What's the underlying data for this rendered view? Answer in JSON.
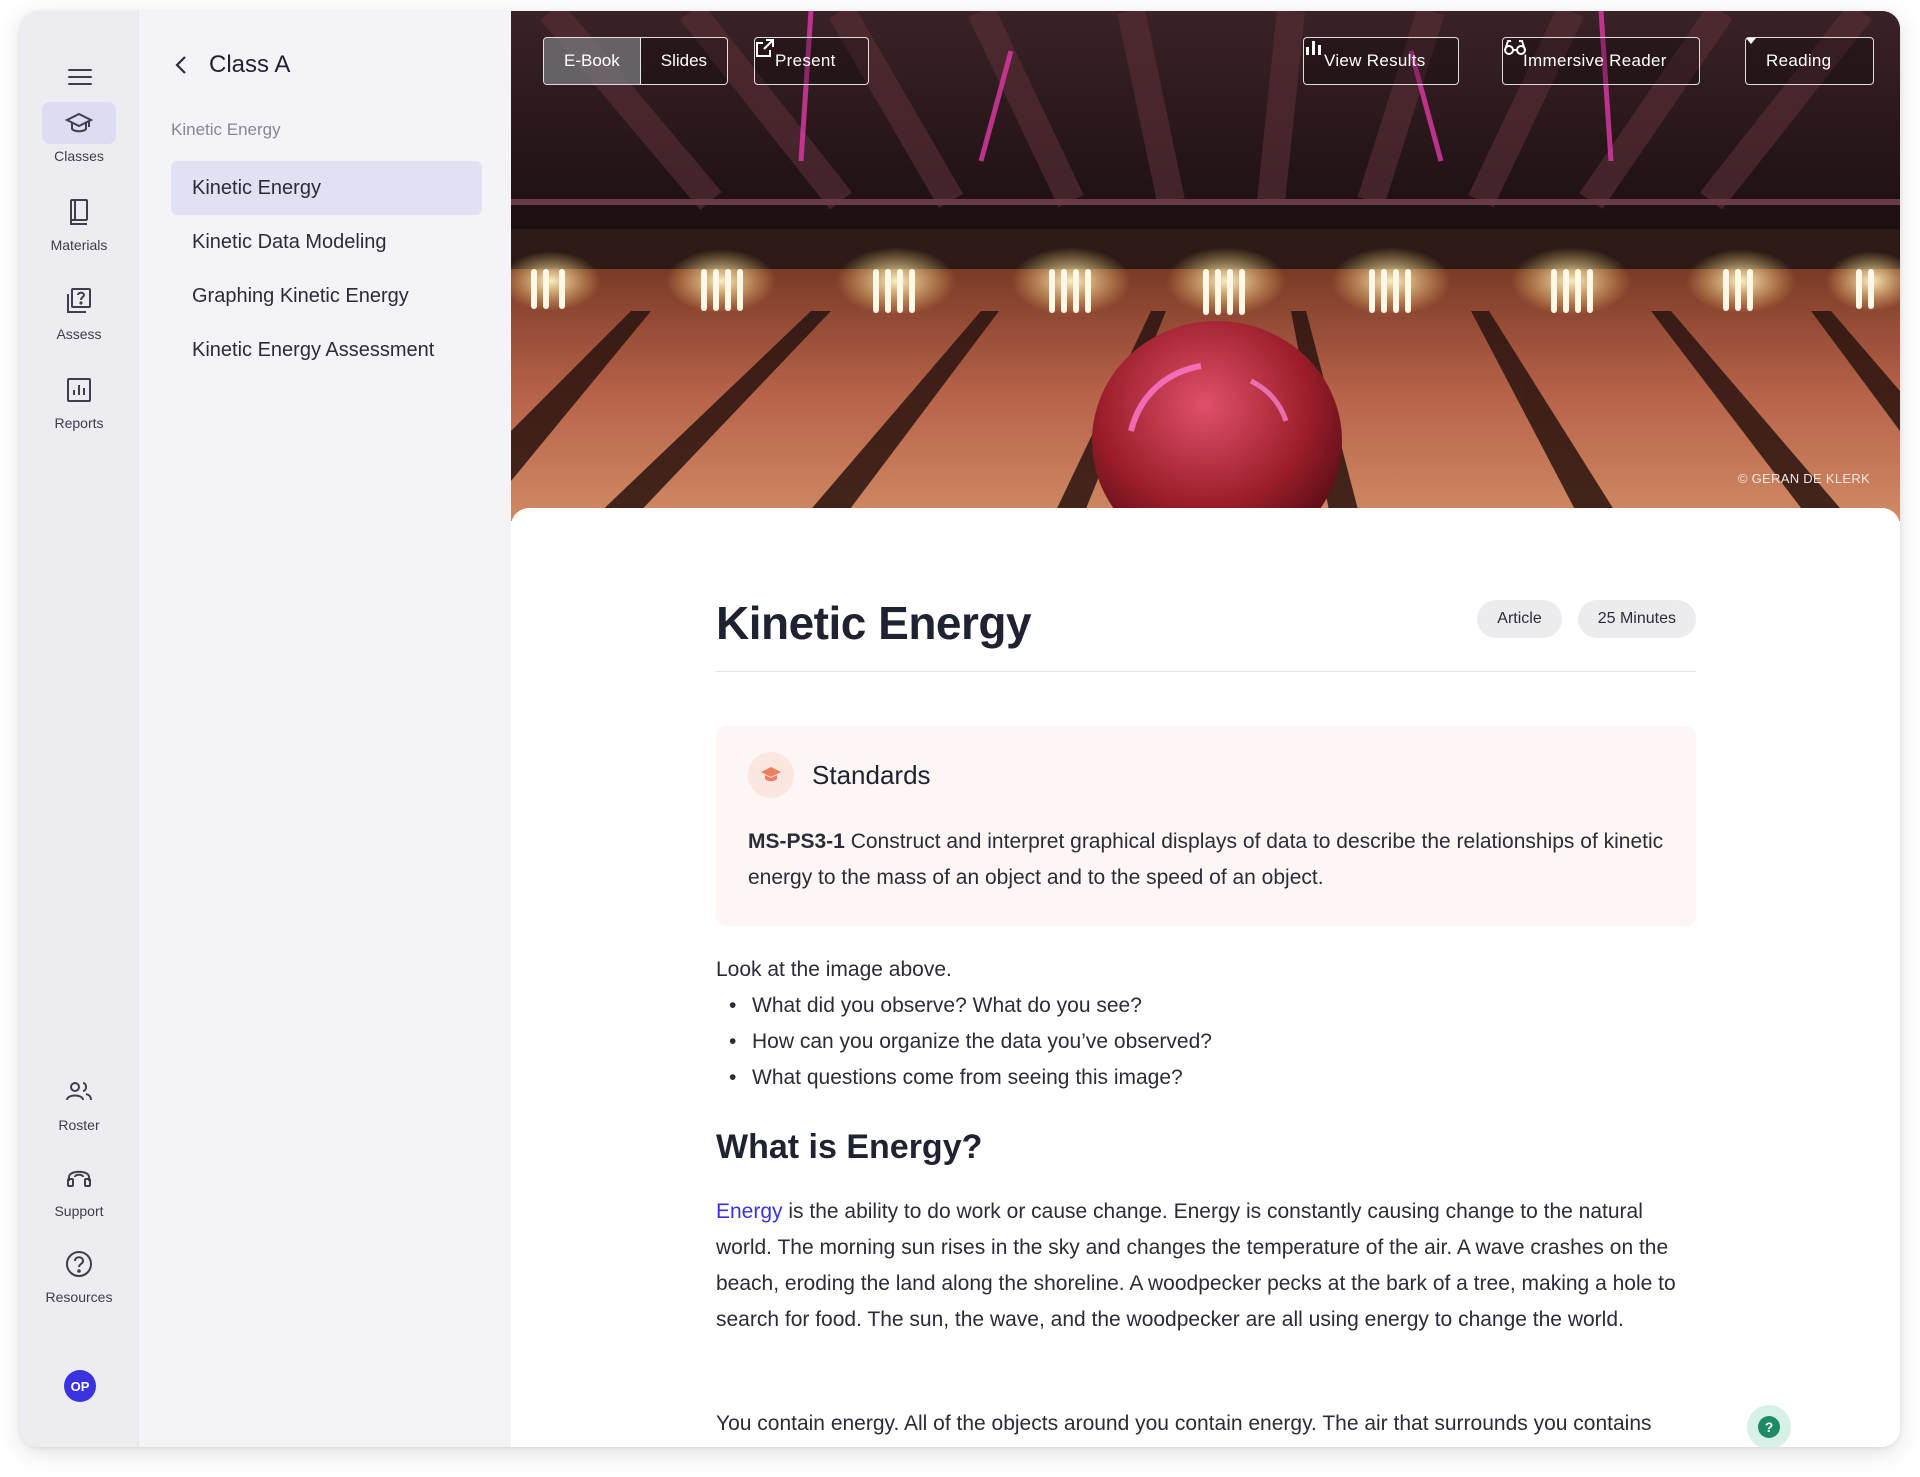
{
  "nav": {
    "items": [
      {
        "label": "Classes",
        "icon": "graduation-cap-icon"
      },
      {
        "label": "Materials",
        "icon": "book-icon"
      },
      {
        "label": "Assess",
        "icon": "quiz-icon"
      },
      {
        "label": "Reports",
        "icon": "bar-chart-icon"
      }
    ],
    "bottom_items": [
      {
        "label": "Roster",
        "icon": "people-icon"
      },
      {
        "label": "Support",
        "icon": "headset-icon"
      },
      {
        "label": "Resources",
        "icon": "help-circle-icon"
      }
    ],
    "avatar_initials": "OP"
  },
  "sidebar": {
    "class_title": "Class A",
    "section_caption": "Kinetic Energy",
    "lessons": [
      {
        "label": "Kinetic Energy",
        "active": true
      },
      {
        "label": "Kinetic Data Modeling"
      },
      {
        "label": "Graphing Kinetic Energy"
      },
      {
        "label": "Kinetic Energy Assessment"
      }
    ]
  },
  "toolbar": {
    "view_modes": [
      "E-Book",
      "Slides"
    ],
    "present_label": "Present",
    "view_results_label": "View Results",
    "immersive_reader_label": "Immersive Reader",
    "reading_label": "Reading"
  },
  "hero": {
    "credit": "© GERAN DE KLERK"
  },
  "article": {
    "title": "Kinetic Energy",
    "pills": [
      "Article",
      "25 Minutes"
    ],
    "standards_heading": "Standards",
    "standard_code": "MS-PS3-1",
    "standard_text": " Construct and interpret graphical displays of data to describe the relationships of kinetic energy to the mass of an object and to the speed of an object.",
    "prompt_intro": "Look at the image above.",
    "prompt_bullets": [
      "What did you observe? What do you see?",
      "How can you organize the data you’ve observed?",
      "What questions come from seeing this image?"
    ],
    "section_heading": "What is Energy?",
    "energy_link": "Energy",
    "para1_rest": " is the ability to do work or cause change. Energy is constantly causing change to the natural world. The morning sun rises in the sky and changes the temperature of the air. A wave crashes on the beach, eroding the land along the shoreline. A woodpecker pecks at the bark of a tree, making a hole to search for food. The sun, the wave, and the woodpecker are all using energy to change the world.",
    "para2": "You contain energy. All of the objects around you contain energy. The air that surrounds you contains energy. Energy is even present in the fabric of your shirt itself. Both scientists and"
  },
  "colors": {
    "accent": "#3b33e0",
    "active_bg": "#e1e1f4",
    "standards_bg": "#fdf6f4",
    "help": "#1e8a66"
  }
}
